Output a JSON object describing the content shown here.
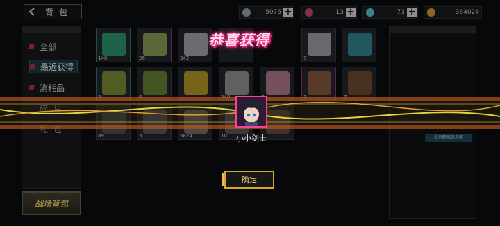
{
  "header": {
    "back_title": "背包"
  },
  "currencies": [
    {
      "icon": "steel-icon",
      "value": "5076",
      "color": "#9aa3ad"
    },
    {
      "icon": "orb-icon",
      "value": "13",
      "color": "#d1497a"
    },
    {
      "icon": "crystal-icon",
      "value": "73",
      "color": "#5fc7d8"
    },
    {
      "icon": "coin-icon",
      "value": "364024",
      "color": "#d6a23a"
    }
  ],
  "sidebar": {
    "items": [
      {
        "label": "全部",
        "active": false
      },
      {
        "label": "最近获得",
        "active": true
      },
      {
        "label": "消耗品",
        "active": false
      },
      {
        "label": "碎片",
        "active": false
      },
      {
        "label": "礼包",
        "active": false
      }
    ],
    "battle_bag": "战场背包"
  },
  "grid": {
    "slots": [
      {
        "count": "140",
        "rarity": "green",
        "icon": "beacon-icon",
        "color": "#2fbf8a"
      },
      {
        "count": "26",
        "rarity": "magenta",
        "icon": "chest-icon",
        "color": "#b3c96a"
      },
      {
        "count": "342",
        "rarity": "plain",
        "icon": "mystery-box-icon",
        "color": "#cfd2d6"
      },
      {
        "count": "",
        "rarity": "plain",
        "icon": "",
        "color": "#25272b"
      },
      {
        "count": "7",
        "rarity": "plain",
        "icon": "ticket-icon",
        "color": "#c9cbd0"
      },
      {
        "count": "",
        "rarity": "cyan",
        "icon": "jump-card-icon",
        "color": "#3aa9b8"
      },
      {
        "count": "5",
        "rarity": "green",
        "icon": "card-x2-icon",
        "color": "#9ab43a"
      },
      {
        "count": "4",
        "rarity": "plain",
        "icon": "card-x2-icon",
        "color": "#7fa63a"
      },
      {
        "count": "",
        "rarity": "plain",
        "icon": "coin-3-icon",
        "color": "#e6c22a"
      },
      {
        "count": "540",
        "rarity": "plain",
        "icon": "bundle-icon",
        "color": "#b9b9b9"
      },
      {
        "count": "1",
        "rarity": "plain",
        "icon": "envelope-icon",
        "color": "#e69ab0"
      },
      {
        "count": "7",
        "rarity": "magenta",
        "icon": "hero-portrait-icon",
        "color": "#a86a4a"
      },
      {
        "count": "7",
        "rarity": "magenta",
        "icon": "hero-portrait-icon",
        "color": "#8a5a3a"
      },
      {
        "count": "89",
        "rarity": "plain",
        "icon": "item-icon",
        "color": "#5a5e66"
      },
      {
        "count": "3",
        "rarity": "plain",
        "icon": "item-icon",
        "color": "#6a6e76"
      },
      {
        "count": "5824",
        "rarity": "plain",
        "icon": "crate-icon",
        "color": "#8e8a80"
      },
      {
        "count": "10",
        "rarity": "plain",
        "icon": "item-icon",
        "color": "#6a6e76"
      },
      {
        "count": "",
        "rarity": "plain",
        "icon": "item-icon",
        "color": "#7a5e4a"
      }
    ]
  },
  "detail": {
    "no_info": "没有物品信息哦"
  },
  "reward": {
    "title": "恭喜获得",
    "name": "小小剑士",
    "confirm": "确定"
  }
}
